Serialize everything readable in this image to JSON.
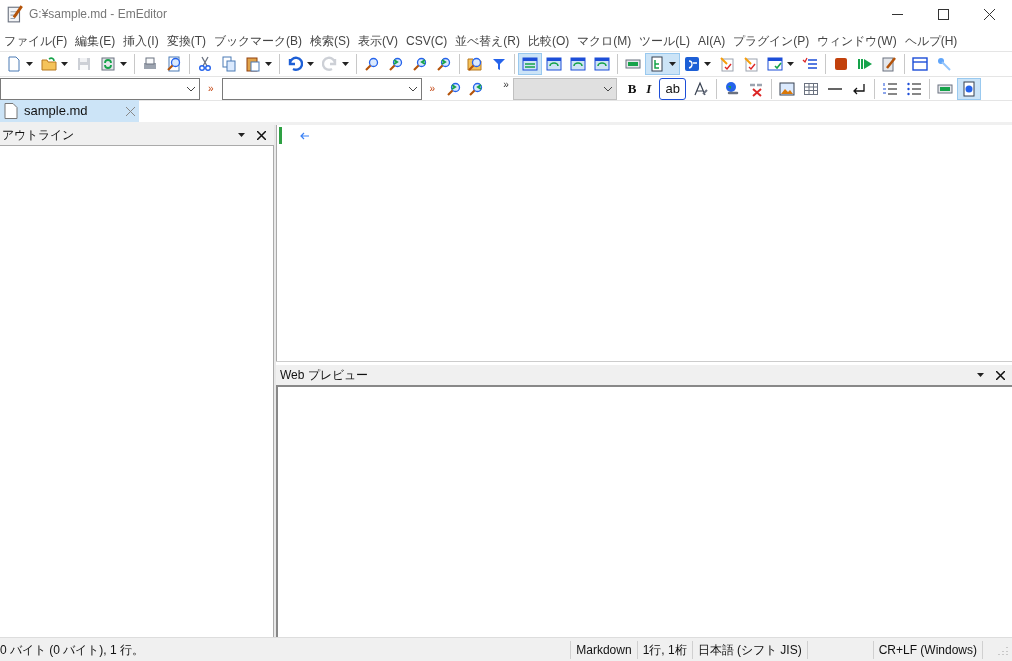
{
  "window": {
    "title": "G:¥sample.md - EmEditor"
  },
  "menu": [
    "ファイル(F)",
    "編集(E)",
    "挿入(I)",
    "変換(T)",
    "ブックマーク(B)",
    "検索(S)",
    "表示(V)",
    "CSV(C)",
    "並べ替え(R)",
    "比較(O)",
    "マクロ(M)",
    "ツール(L)",
    "AI(A)",
    "プラグイン(P)",
    "ウィンドウ(W)",
    "ヘルプ(H)"
  ],
  "toolbar": [
    [
      {
        "pressed": false,
        "dropdown": true,
        "disabled": false
      },
      {
        "pressed": false,
        "dropdown": true,
        "disabled": false
      },
      {
        "pressed": false,
        "dropdown": false,
        "disabled": true
      },
      {
        "pressed": false,
        "dropdown": true,
        "disabled": false
      }
    ],
    [
      {
        "pressed": false,
        "dropdown": false,
        "disabled": false
      },
      {
        "pressed": false,
        "dropdown": false,
        "disabled": false
      }
    ],
    [
      {
        "pressed": false,
        "dropdown": false,
        "disabled": false
      },
      {
        "pressed": false,
        "dropdown": false,
        "disabled": false
      },
      {
        "pressed": false,
        "dropdown": true,
        "disabled": false
      }
    ],
    [
      {
        "pressed": false,
        "dropdown": true,
        "disabled": false
      },
      {
        "pressed": false,
        "dropdown": true,
        "disabled": true
      }
    ],
    [
      {
        "pressed": false,
        "dropdown": false,
        "disabled": false
      },
      {
        "pressed": false,
        "dropdown": false,
        "disabled": false
      },
      {
        "pressed": false,
        "dropdown": false,
        "disabled": false
      },
      {
        "pressed": false,
        "dropdown": false,
        "disabled": false
      }
    ],
    [
      {
        "pressed": false,
        "dropdown": false,
        "disabled": false
      },
      {
        "pressed": false,
        "dropdown": false,
        "disabled": false
      }
    ],
    [
      {
        "pressed": true,
        "dropdown": false,
        "disabled": false
      },
      {
        "pressed": false,
        "dropdown": false,
        "disabled": false
      },
      {
        "pressed": false,
        "dropdown": false,
        "disabled": false
      },
      {
        "pressed": false,
        "dropdown": false,
        "disabled": false
      }
    ],
    [
      {
        "pressed": false,
        "dropdown": false,
        "disabled": false
      },
      {
        "pressed": true,
        "dropdown": true,
        "disabled": false
      },
      {
        "pressed": false,
        "dropdown": true,
        "disabled": false
      },
      {
        "pressed": false,
        "dropdown": false,
        "disabled": false
      },
      {
        "pressed": false,
        "dropdown": false,
        "disabled": false
      },
      {
        "pressed": false,
        "dropdown": true,
        "disabled": false
      },
      {
        "pressed": false,
        "dropdown": false,
        "disabled": false
      }
    ],
    [
      {
        "pressed": false,
        "dropdown": false,
        "disabled": false
      },
      {
        "pressed": false,
        "dropdown": false,
        "disabled": false
      },
      {
        "pressed": false,
        "dropdown": false,
        "disabled": false
      }
    ],
    [
      {
        "pressed": false,
        "dropdown": false,
        "disabled": false
      },
      {
        "pressed": false,
        "dropdown": false,
        "disabled": false
      }
    ]
  ],
  "find_bar": {
    "separator": "»",
    "search_buttons": [
      {
        "pressed": false
      },
      {
        "pressed": false
      }
    ],
    "overflow": "»"
  },
  "format_bar": {
    "font_field": {
      "disabled": true
    },
    "text_buttons": [
      {
        "label": "B",
        "pressed": false
      },
      {
        "label": "I",
        "pressed": false
      },
      {
        "label": "ab",
        "pressed": false
      }
    ],
    "groups": [
      [
        {
          "pressed": false
        }
      ],
      [
        {
          "pressed": false
        },
        {
          "pressed": false
        }
      ],
      [
        {
          "pressed": false
        },
        {
          "pressed": false
        },
        {
          "pressed": false
        },
        {
          "pressed": false
        }
      ],
      [
        {
          "pressed": false
        },
        {
          "pressed": false
        }
      ],
      [
        {
          "pressed": false
        },
        {
          "pressed": true
        }
      ]
    ]
  },
  "tabs": [
    {
      "label": "sample.md",
      "selected": true
    }
  ],
  "outline": {
    "title": "アウトライン"
  },
  "preview": {
    "title": "Web プレビュー"
  },
  "status_bar": {
    "info": "0 バイト (0 バイト), 1 行。",
    "cells": [
      "Markdown",
      "1行, 1桁",
      "日本語 (シフト JIS)"
    ],
    "line_ending": "CR+LF (Windows)"
  }
}
